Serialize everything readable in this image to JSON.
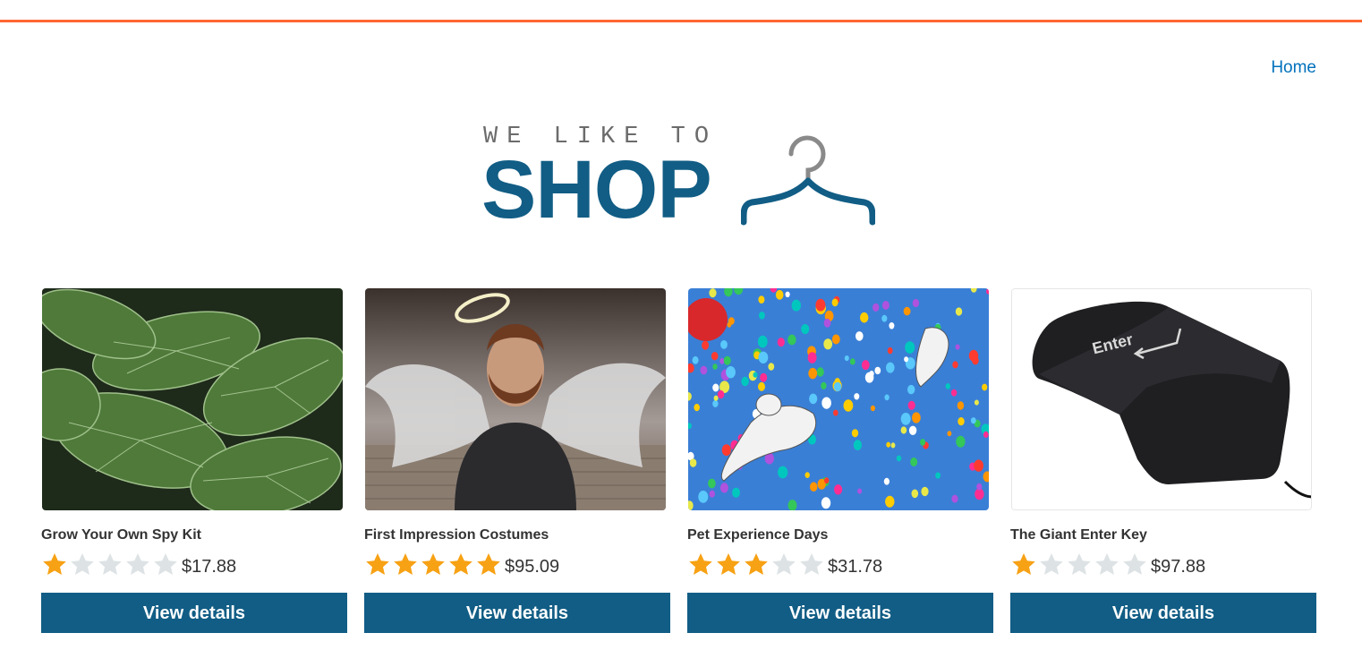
{
  "nav": {
    "home_label": "Home"
  },
  "logo": {
    "tagline": "WE LIKE TO",
    "word": "SHOP"
  },
  "colors": {
    "accent_bar": "#ff6633",
    "brand": "#115d85",
    "link": "#0071bc",
    "star_filled": "#f7a114",
    "star_empty": "#dde3e5"
  },
  "products": [
    {
      "title": "Grow Your Own Spy Kit",
      "rating": 1,
      "price": "$17.88",
      "button": "View details",
      "image": "leaves-image"
    },
    {
      "title": "First Impression Costumes",
      "rating": 5,
      "price": "$95.09",
      "button": "View details",
      "image": "angel-man-image"
    },
    {
      "title": "Pet Experience Days",
      "rating": 3,
      "price": "$31.78",
      "button": "View details",
      "image": "balloon-dogs-image"
    },
    {
      "title": "The Giant Enter Key",
      "rating": 1,
      "price": "$97.88",
      "button": "View details",
      "image": "enter-key-image"
    }
  ]
}
